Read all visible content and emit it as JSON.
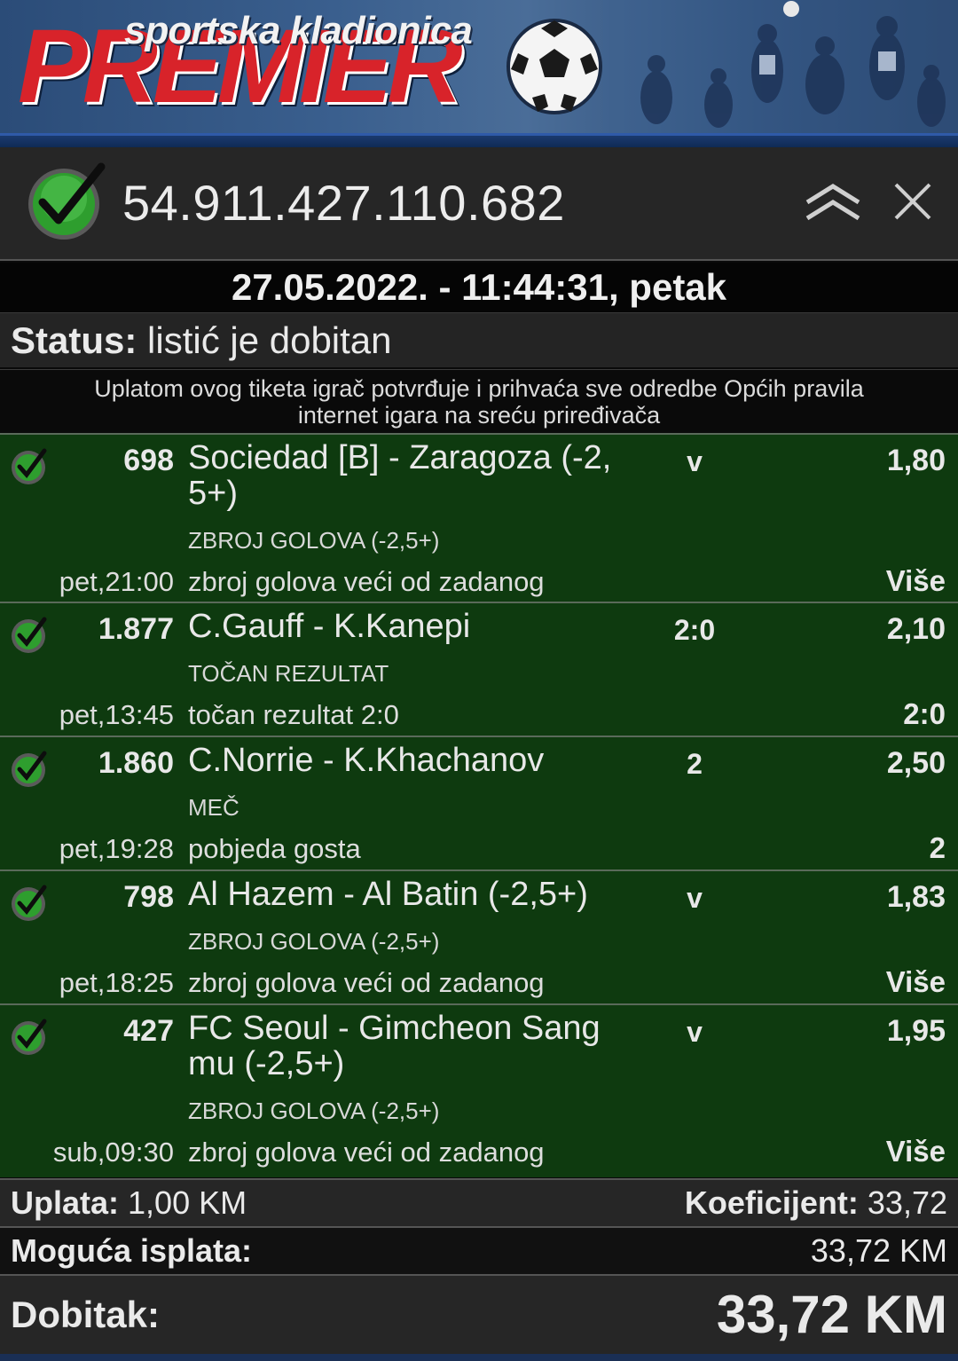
{
  "banner": {
    "subtitle": "sportska kladionica",
    "brand": "PREMIER"
  },
  "ticket": {
    "number": "54.911.427.110.682",
    "datetime": "27.05.2022. - 11:44:31, petak",
    "status_label": "Status:",
    "status_value": "listić je dobitan",
    "notice_line1": "Uplatom ovog tiketa igrač potvrđuje i prihvaća sve odredbe Općih pravila",
    "notice_line2": "internet igara na sreću priređivača"
  },
  "bets": [
    {
      "code": "698",
      "match_line1": "Sociedad [B] - Zaragoza (-2,",
      "match_line2": "5+)",
      "pick": "v",
      "odd": "1,80",
      "market": "ZBROJ GOLOVA (-2,5+)",
      "time": "pet,21:00",
      "description": "zbroj golova veći od zadanog",
      "result": "Više"
    },
    {
      "code": "1.877",
      "match_line1": "C.Gauff - K.Kanepi",
      "match_line2": "",
      "pick": "2:0",
      "odd": "2,10",
      "market": "TOČAN REZULTAT",
      "time": "pet,13:45",
      "description": "točan rezultat 2:0",
      "result": "2:0"
    },
    {
      "code": "1.860",
      "match_line1": "C.Norrie - K.Khachanov",
      "match_line2": "",
      "pick": "2",
      "odd": "2,50",
      "market": "MEČ",
      "time": "pet,19:28",
      "description": "pobjeda gosta",
      "result": "2"
    },
    {
      "code": "798",
      "match_line1": "Al Hazem - Al Batin (-2,5+)",
      "match_line2": "",
      "pick": "v",
      "odd": "1,83",
      "market": "ZBROJ GOLOVA (-2,5+)",
      "time": "pet,18:25",
      "description": "zbroj golova veći od zadanog",
      "result": "Više"
    },
    {
      "code": "427",
      "match_line1": "FC Seoul - Gimcheon Sang",
      "match_line2": "mu (-2,5+)",
      "pick": "v",
      "odd": "1,95",
      "market": "ZBROJ GOLOVA (-2,5+)",
      "time": "sub,09:30",
      "description": "zbroj golova veći od zadanog",
      "result": "Više"
    }
  ],
  "summary": {
    "stake_label": "Uplata:",
    "stake_value": "1,00 KM",
    "coef_label": "Koeficijent:",
    "coef_value": "33,72",
    "payout_label": "Moguća isplata:",
    "payout_value": "33,72 KM",
    "win_label": "Dobitak:",
    "win_value": "33,72 KM"
  },
  "colors": {
    "bet_bg": "#0e3a0f",
    "brand_red": "#d8232a",
    "check_green": "#2e9e2e"
  },
  "icons": [
    "check-icon",
    "collapse-up-icon",
    "close-icon",
    "football-icon"
  ]
}
